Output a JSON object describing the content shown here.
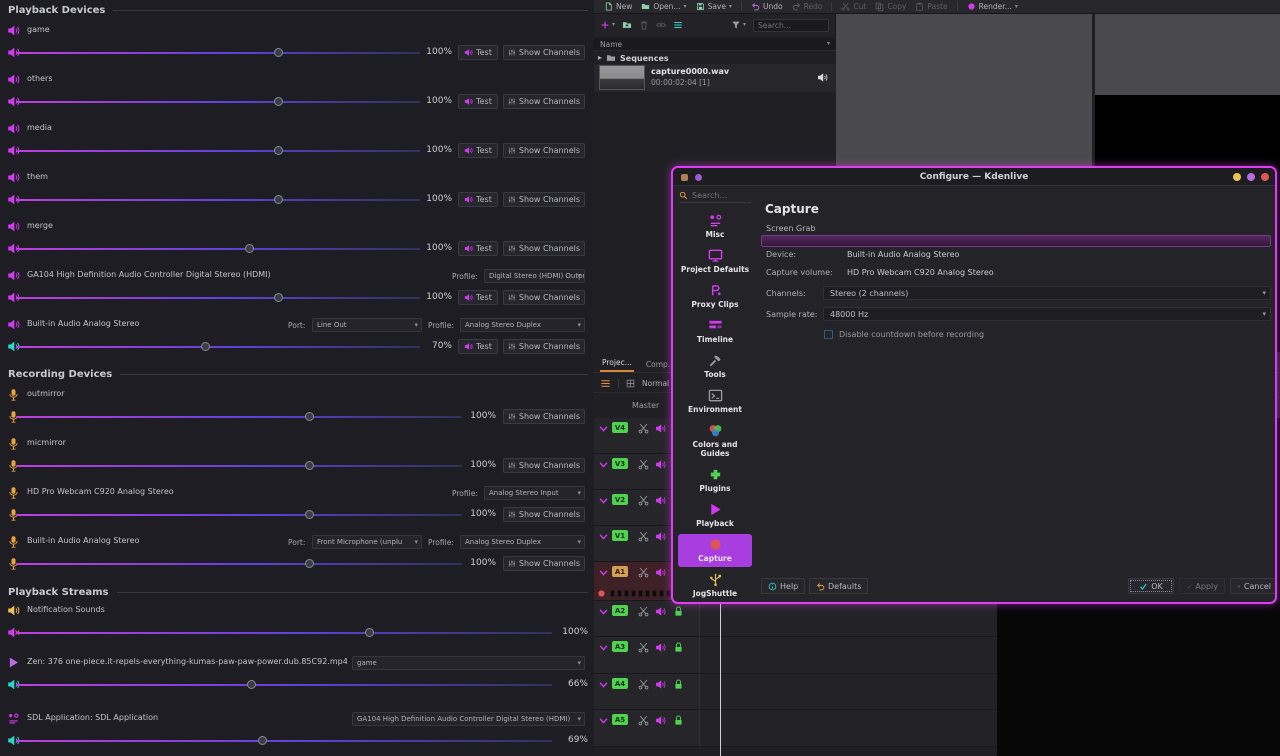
{
  "colors": {
    "accent_magenta": "#d23bef",
    "dialog_border": "#df3df2",
    "selected_purple": "#a93ee0",
    "record_red": "#e03a3a",
    "tab_underline_orange": "#d8883a",
    "recording_orange": "#e8a33d",
    "mute_teal": "#2fd5c8",
    "track_tag_green": "#4fd24f",
    "window_buttons": [
      "#e8c252",
      "#b96be0",
      "#e05656"
    ]
  },
  "icons": {
    "caret_down": "▾",
    "triangle_right": "▸"
  },
  "mixer": {
    "sections": {
      "playback_devices": "Playback Devices",
      "recording_devices": "Recording Devices",
      "playback_streams": "Playback Streams"
    },
    "labels": {
      "test": "Test",
      "show_channels": "Show Channels",
      "profile": "Profile:",
      "port": "Port:"
    },
    "playback_devices": [
      {
        "name": "game",
        "volume": "100%",
        "pct": 65
      },
      {
        "name": "others",
        "volume": "100%",
        "pct": 65
      },
      {
        "name": "media",
        "volume": "100%",
        "pct": 65
      },
      {
        "name": "them",
        "volume": "100%",
        "pct": 65
      },
      {
        "name": "merge",
        "volume": "100%",
        "pct": 58
      },
      {
        "name": "GA104 High Definition Audio Controller Digital Stereo (HDMI)",
        "profile": "Digital Stereo (HDMI) Output",
        "volume": "100%",
        "pct": 65
      },
      {
        "name": "Built-in Audio Analog Stereo",
        "port": "Line Out",
        "profile": "Analog Stereo Duplex",
        "volume": "70%",
        "pct": 47
      }
    ],
    "recording_devices": [
      {
        "name": "outmirror",
        "volume": "100%",
        "pct": 66
      },
      {
        "name": "micmirror",
        "volume": "100%",
        "pct": 66
      },
      {
        "name": "HD Pro Webcam C920 Analog Stereo",
        "profile": "Analog Stereo Input",
        "volume": "100%",
        "pct": 66
      },
      {
        "name": "Built-in Audio Analog Stereo",
        "port": "Front Microphone (unplu",
        "profile": "Analog Stereo Duplex",
        "volume": "100%",
        "pct": 66
      }
    ],
    "playback_streams": [
      {
        "name": "Notification Sounds",
        "volume": "100%",
        "pct": 66
      },
      {
        "name": "Zen: 376 one-piece.it-repels-everything-kumas-paw-paw-power.dub.85C92.mp4",
        "target": "game",
        "volume": "66%",
        "pct": 44
      },
      {
        "name": "SDL Application: SDL Application",
        "target": "GA104 High Definition Audio Controller Digital Stereo (HDMI)",
        "volume": "69%",
        "pct": 46
      }
    ]
  },
  "kdenlive": {
    "toolbar": {
      "new": "New",
      "open": "Open...",
      "save": "Save",
      "undo": "Undo",
      "redo": "Redo",
      "cut": "Cut",
      "copy": "Copy",
      "paste": "Paste",
      "render": "Render..."
    },
    "bin": {
      "search_placeholder": "Search...",
      "name_column": "Name",
      "folder": "Sequences",
      "clip_name": "capture0000.wav",
      "clip_meta": "00:00:02:04 [1]"
    },
    "panel_tabs": {
      "project": "Projec...",
      "compositions": "Comp..."
    },
    "timeline": {
      "edit_mode": "Normal M...",
      "master": "Master",
      "tracks": [
        {
          "tag": "V4"
        },
        {
          "tag": "V3"
        },
        {
          "tag": "V2"
        },
        {
          "tag": "V1"
        },
        {
          "tag": "A1"
        },
        {
          "tag": "A2"
        },
        {
          "tag": "A3"
        },
        {
          "tag": "A4"
        },
        {
          "tag": "A5"
        }
      ]
    }
  },
  "dialog": {
    "title": "Configure — Kdenlive",
    "search_placeholder": "Search...",
    "sidebar": [
      {
        "label": "Misc"
      },
      {
        "label": "Project Defaults"
      },
      {
        "label": "Proxy Clips"
      },
      {
        "label": "Timeline"
      },
      {
        "label": "Tools"
      },
      {
        "label": "Environment"
      },
      {
        "label": "Colors and Guides"
      },
      {
        "label": "Plugins"
      },
      {
        "label": "Playback"
      },
      {
        "label": "Capture"
      },
      {
        "label": "JogShuttle"
      }
    ],
    "selected_item": "Capture",
    "page_title": "Capture",
    "tab_label": "Screen Grab",
    "fields": {
      "device_label": "Device:",
      "device_value": "Built-in Audio Analog Stereo",
      "volume_label": "Capture volume:",
      "volume_value": "HD Pro Webcam C920 Analog Stereo",
      "channels_label": "Channels:",
      "channels_value": "Stereo (2 channels)",
      "samplerate_label": "Sample rate:",
      "samplerate_value": "48000 Hz",
      "countdown_label": "Disable countdown before recording"
    },
    "buttons": {
      "help": "Help",
      "defaults": "Defaults",
      "ok": "OK",
      "apply": "Apply",
      "cancel": "Cancel"
    }
  }
}
